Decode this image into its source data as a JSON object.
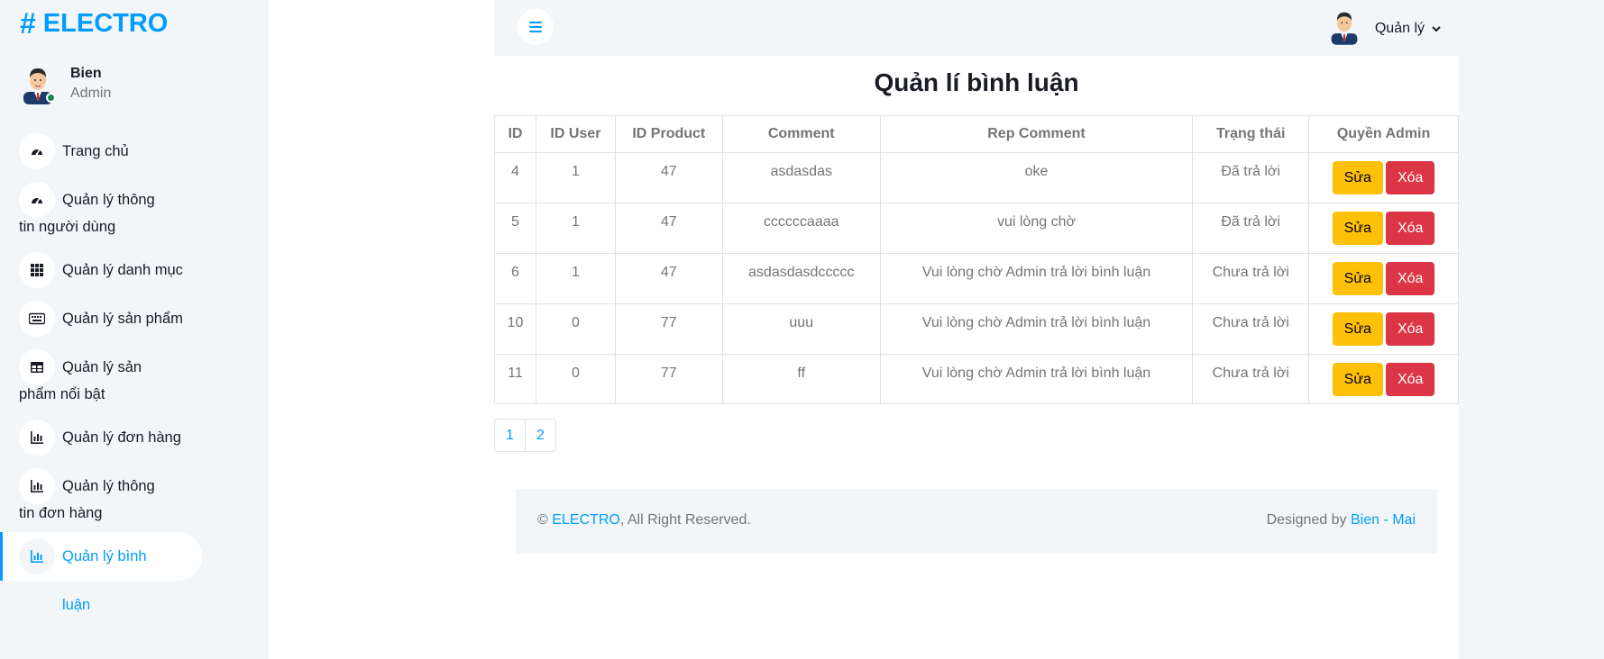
{
  "brand": {
    "hash": "#",
    "name": "ELECTRO"
  },
  "profile": {
    "name": "Bien",
    "role": "Admin"
  },
  "sidebar": {
    "items": [
      {
        "label": "Trang chủ",
        "icon": "tachometer-icon"
      },
      {
        "label": "Quản lý thông tin người dùng",
        "icon": "tachometer-icon"
      },
      {
        "label": "Quản lý danh mục",
        "icon": "grid-icon"
      },
      {
        "label": "Quản lý sản phẩm",
        "icon": "keyboard-icon"
      },
      {
        "label": "Quản lý sản phẩm nổi bật",
        "icon": "table-icon"
      },
      {
        "label": "Quản lý đơn hàng",
        "icon": "bar-chart-icon"
      },
      {
        "label": "Quản lý thông tin đơn hàng",
        "icon": "bar-chart-icon"
      },
      {
        "label": "Quản lý bình luận",
        "icon": "bar-chart-icon",
        "active": true
      }
    ]
  },
  "topbar": {
    "user_label": "Quản lý"
  },
  "page": {
    "title": "Quản lí bình luận"
  },
  "table": {
    "headers": [
      "ID",
      "ID User",
      "ID Product",
      "Comment",
      "Rep Comment",
      "Trạng thái",
      "Quyền Admin"
    ],
    "rows": [
      [
        "4",
        "1",
        "47",
        "asdasdas",
        "oke",
        "Đã trả lời"
      ],
      [
        "5",
        "1",
        "47",
        "ccccccaaaa",
        "vui lòng chờ",
        "Đã trả lời"
      ],
      [
        "6",
        "1",
        "47",
        "asdasdasdccccc",
        "Vui lòng chờ Admin trả lời bình luận",
        "Chưa trả lời"
      ],
      [
        "10",
        "0",
        "77",
        "uuu",
        "Vui lòng chờ Admin trả lời bình luận",
        "Chưa trả lời"
      ],
      [
        "11",
        "0",
        "77",
        "ff",
        "Vui lòng chờ Admin trả lời bình luận",
        "Chưa trả lời"
      ]
    ],
    "edit_label": "Sửa",
    "delete_label": "Xóa"
  },
  "pagination": {
    "pages": [
      "1",
      "2"
    ]
  },
  "footer": {
    "copyright_symbol": "©",
    "brand_link": "ELECTRO",
    "rights": ", All Right Reserved.",
    "designed_by": "Designed by",
    "designer_link": "Bien - Mai"
  },
  "colors": {
    "accent": "#009cff",
    "sidebar_bg": "#f3f6f9",
    "edit_button": "#ffc107",
    "delete_button": "#dc3545"
  }
}
